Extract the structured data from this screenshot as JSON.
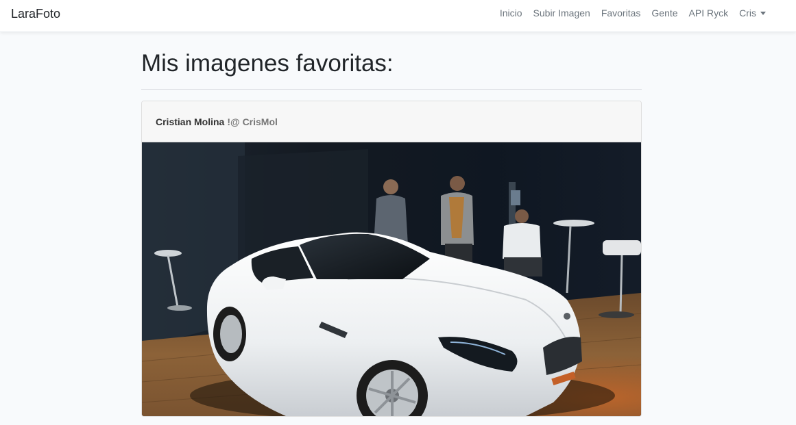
{
  "navbar": {
    "brand": "LaraFoto",
    "links": [
      {
        "label": "Inicio"
      },
      {
        "label": "Subir Imagen"
      },
      {
        "label": "Favoritas"
      },
      {
        "label": "Gente"
      },
      {
        "label": "API Ryck"
      }
    ],
    "user_menu": "Cris"
  },
  "main": {
    "title": "Mis imagenes favoritas:",
    "posts": [
      {
        "author_name": "Cristian Molina",
        "author_nick": "!@ CrisMol",
        "image_alt": "photo-white-convertible-car-showroom"
      }
    ]
  },
  "colors": {
    "navbar_bg": "#ffffff",
    "page_bg": "#f8fafc",
    "card_header_bg": "#f7f7f7",
    "nav_link": "#6c757d"
  }
}
